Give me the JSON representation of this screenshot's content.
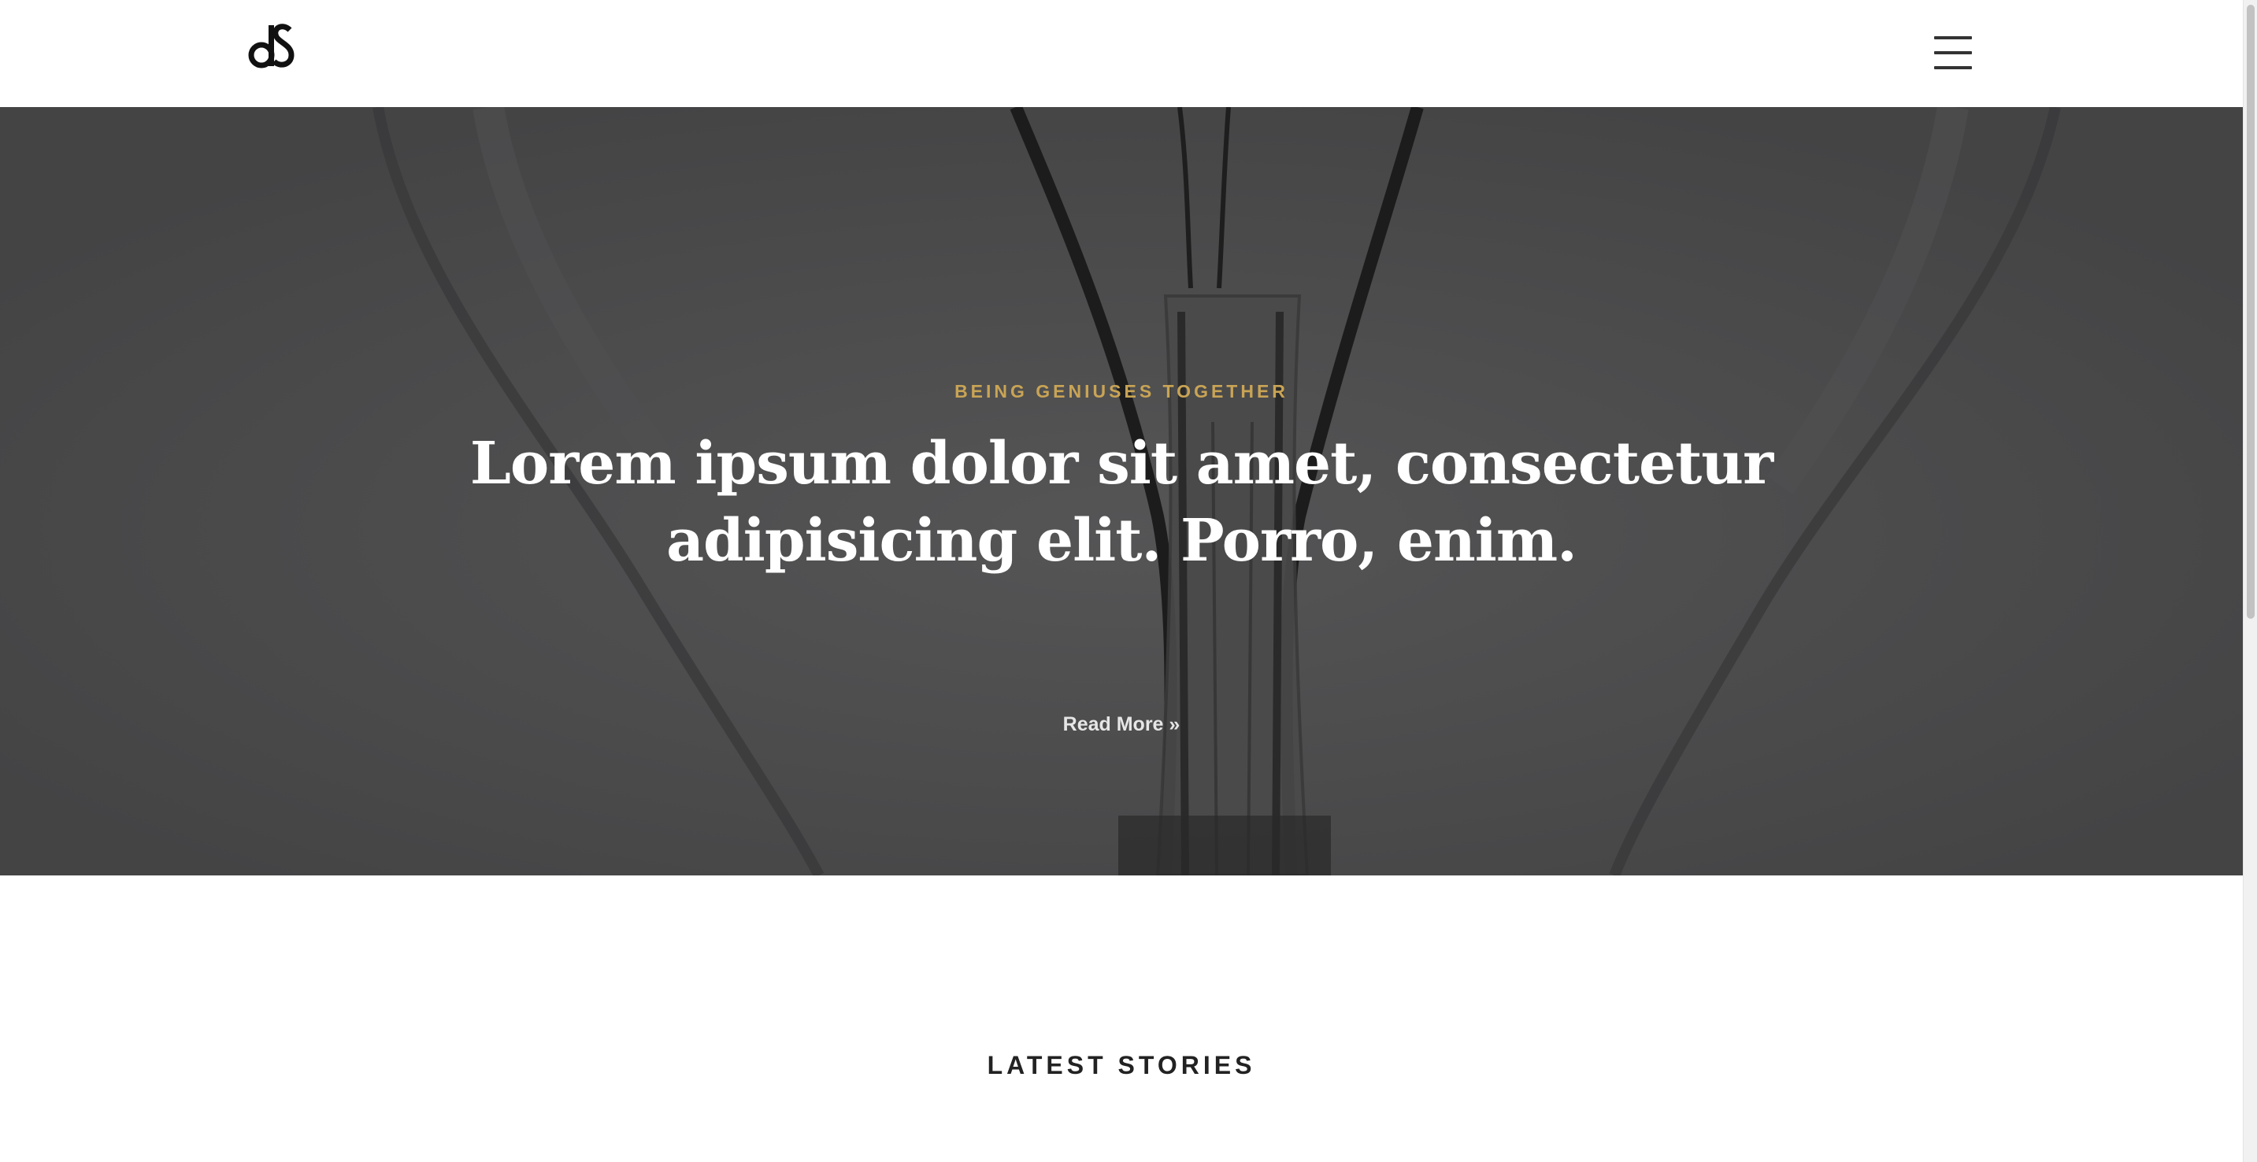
{
  "header": {
    "logo_icon": "ds-monogram-logo",
    "menu_icon": "hamburger-menu-icon"
  },
  "hero": {
    "eyebrow": "BEING GENIUSES TOGETHER",
    "title": "Lorem ipsum dolor sit amet, consectetur adipisicing elit. Porro, enim.",
    "read_more": "Read More »",
    "background_image": "light-bulb-filament-photo",
    "colors": {
      "overlay": "#4b4b4c",
      "eyebrow": "#c9a455",
      "title": "#ffffff"
    }
  },
  "latest": {
    "heading": "LATEST STORIES"
  }
}
